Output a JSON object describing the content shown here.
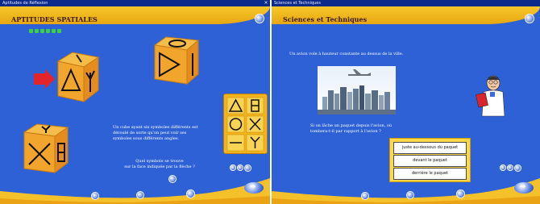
{
  "colors": {
    "background": "#2f61d6",
    "header": "#f3b81f",
    "cube": "#f2a52c",
    "arrow": "#e3252a",
    "dots": "#3cd047"
  },
  "left_window": {
    "titlebar_text": "Aptitudes de Réflexion",
    "header_title": "APTITUDES SPATIALES",
    "progress_dots": 6,
    "instruction_text": "Un cube ayant six symboles différents est\ndéroulé de sorte qu'on peut voir ses\nsymboles sous différents angles.",
    "question_text": "Quel symbole se trouve\nsur la face indiquée par la flèche ?",
    "close_icon": "close-icon",
    "nav_icon": "next-arrow-icon"
  },
  "right_window": {
    "titlebar_text": "Sciences et Techniques",
    "header_title": "Sciences et Techniques",
    "intro_text": "Un avion vole à hauteur constante au dessus de la ville.",
    "question_text": "Si on lâche un paquet depuis l'avion, où\ntombera-t-il par rapport à l'avion ?",
    "answers": [
      "juste au-dessous du paquet",
      "devant le paquet",
      "derrière le paquet"
    ],
    "nav_icon": "next-arrow-icon"
  }
}
